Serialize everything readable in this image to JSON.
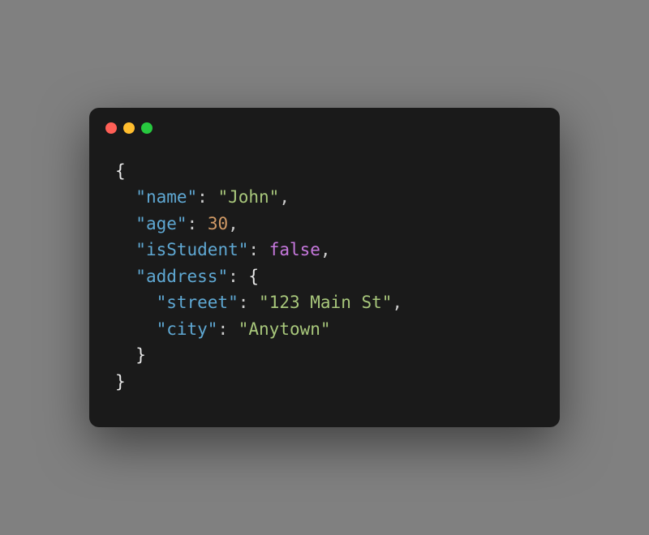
{
  "traffic": {
    "close": "close",
    "minimize": "minimize",
    "maximize": "maximize"
  },
  "code": {
    "open_brace": "{",
    "close_brace": "}",
    "indent1": "  ",
    "indent2": "    ",
    "colon": ":",
    "comma": ",",
    "space": " ",
    "keys": {
      "name": "\"name\"",
      "age": "\"age\"",
      "isStudent": "\"isStudent\"",
      "address": "\"address\"",
      "street": "\"street\"",
      "city": "\"city\""
    },
    "values": {
      "name": "\"John\"",
      "age": "30",
      "isStudent": "false",
      "street": "\"123 Main St\"",
      "city": "\"Anytown\""
    }
  }
}
